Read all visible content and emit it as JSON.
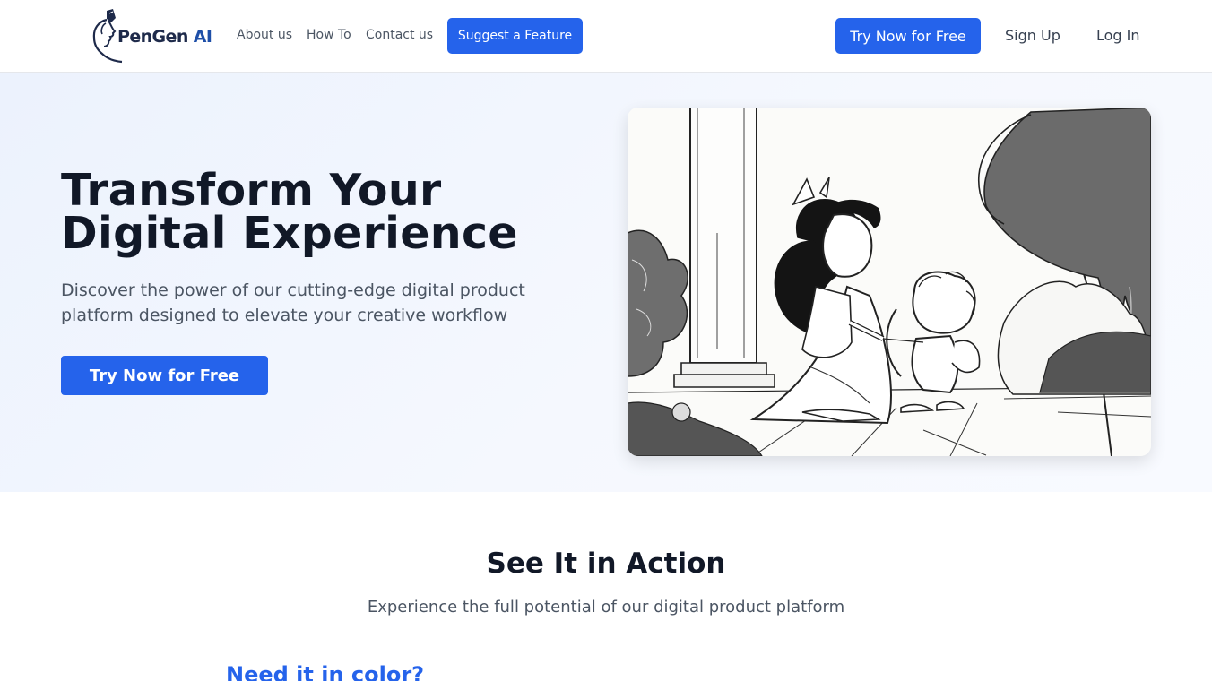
{
  "header": {
    "logo": {
      "text_main": "PenGen",
      "text_accent": "AI",
      "icon": "pen-head-logo-icon"
    },
    "nav": {
      "about": "About us",
      "howto": "How To",
      "contact": "Contact us",
      "suggest": "Suggest a Feature"
    },
    "try_now": "Try Now for Free",
    "sign_up": "Sign Up",
    "log_in": "Log In"
  },
  "hero": {
    "title_line1": "Transform Your",
    "title_line2": "Digital Experience",
    "subtitle": "Discover the power of our cutting-edge digital product platform designed to elevate your creative workflow",
    "cta": "Try Now for Free",
    "image": {
      "icon": "coloring-page-illustration"
    }
  },
  "section": {
    "title": "See It in Action",
    "subtitle": "Experience the full potential of our digital product platform",
    "color_heading": "Need it in color?"
  },
  "colors": {
    "primary": "#2563eb",
    "heading": "#111827",
    "body_text": "#4b5563",
    "logo_navy": "#1e2a4a"
  }
}
